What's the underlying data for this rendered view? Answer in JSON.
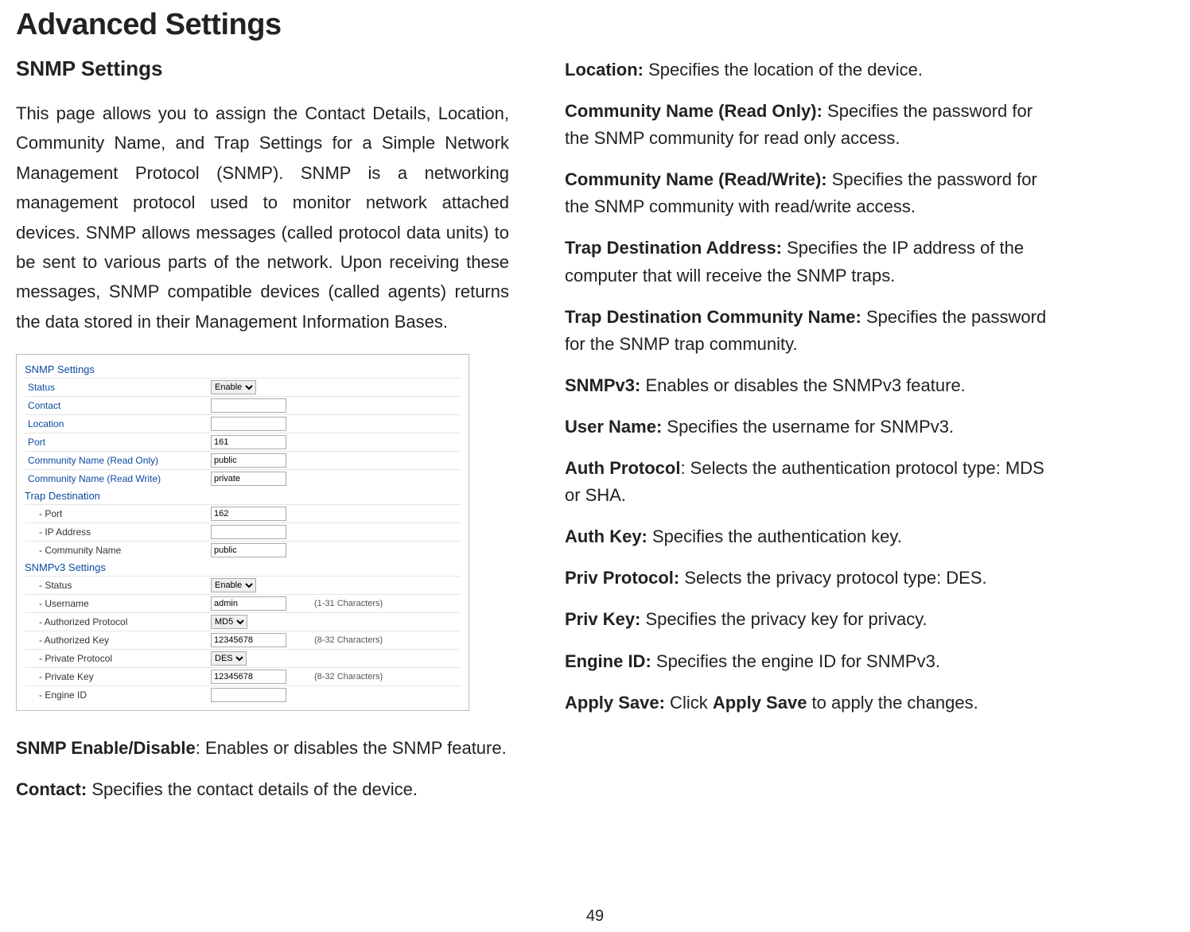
{
  "page": {
    "title": "Advanced Settings",
    "pagenum": "49"
  },
  "left": {
    "heading": "SNMP Settings",
    "intro": "This page allows you to assign the Contact Details, Location, Community Name, and Trap Settings for a Simple Network Management Protocol (SNMP). SNMP is a networking management protocol used to monitor network attached devices. SNMP allows messages (called protocol data units) to be sent to various parts of the network. Upon receiving these messages, SNMP compatible devices (called agents) returns the data stored in their Management Information Bases."
  },
  "screenshot": {
    "title": "SNMP Settings",
    "status_label": "Status",
    "status_value": "Enable",
    "contact_label": "Contact",
    "contact_value": "",
    "location_label": "Location",
    "location_value": "",
    "port_label": "Port",
    "port_value": "161",
    "comm_ro_label": "Community Name (Read Only)",
    "comm_ro_value": "public",
    "comm_rw_label": "Community Name (Read Write)",
    "comm_rw_value": "private",
    "trap_title": "Trap Destination",
    "trap_port_label": "- Port",
    "trap_port_value": "162",
    "trap_ip_label": "- IP Address",
    "trap_ip_value": "",
    "trap_comm_label": "- Community Name",
    "trap_comm_value": "public",
    "v3_title": "SNMPv3 Settings",
    "v3_status_label": "- Status",
    "v3_status_value": "Enable",
    "v3_user_label": "- Username",
    "v3_user_value": "admin",
    "v3_user_note": "(1-31 Characters)",
    "v3_authp_label": "- Authorized Protocol",
    "v3_authp_value": "MD5",
    "v3_authk_label": "- Authorized Key",
    "v3_authk_value": "12345678",
    "v3_authk_note": "(8-32 Characters)",
    "v3_privp_label": "- Private Protocol",
    "v3_privp_value": "DES",
    "v3_privk_label": "- Private Key",
    "v3_privk_value": "12345678",
    "v3_privk_note": "(8-32 Characters)",
    "v3_engine_label": "- Engine ID",
    "v3_engine_value": ""
  },
  "defs": {
    "d1_term": "SNMP Enable/Disable",
    "d1_sep": ": ",
    "d1_desc": "Enables or disables the SNMP feature.",
    "d2_term": "Contact:",
    "d2_desc": " Specifies the contact details of the device.",
    "r1_term": "Location:",
    "r1_desc": " Specifies the location of the device.",
    "r2_term": "Community Name (Read Only):",
    "r2_desc": " Specifies the password for the SNMP community for read only access.",
    "r3_term": "Community Name (Read/Write):",
    "r3_desc": " Specifies the password for the SNMP community with read/write access.",
    "r4_term": "Trap Destination Address:",
    "r4_desc": " Specifies the IP address of the computer that will receive the SNMP traps.",
    "r5_term": "Trap Destination Community Name:",
    "r5_desc": " Specifies the password for the SNMP trap community.",
    "r6_term": "SNMPv3:",
    "r6_desc": " Enables or disables the SNMPv3 feature.",
    "r7_term": "User Name:",
    "r7_desc": " Specifies the username for SNMPv3.",
    "r8_term": "Auth Protocol",
    "r8_sep": ": ",
    "r8_desc": "Selects the authentication protocol type: MDS or SHA.",
    "r9_term": "Auth Key:",
    "r9_desc": " Specifies the authentication key.",
    "r10_term": "Priv Protocol:",
    "r10_desc": " Selects the privacy protocol type: DES.",
    "r11_term": "Priv Key:",
    "r11_desc": " Specifies the privacy key for privacy.",
    "r12_term": "Engine ID:",
    "r12_desc": " Specifies the engine ID for SNMPv3.",
    "r13_term": "Apply Save:",
    "r13_mid": " Click ",
    "r13_bold": "Apply Save",
    "r13_end": " to apply the changes."
  }
}
